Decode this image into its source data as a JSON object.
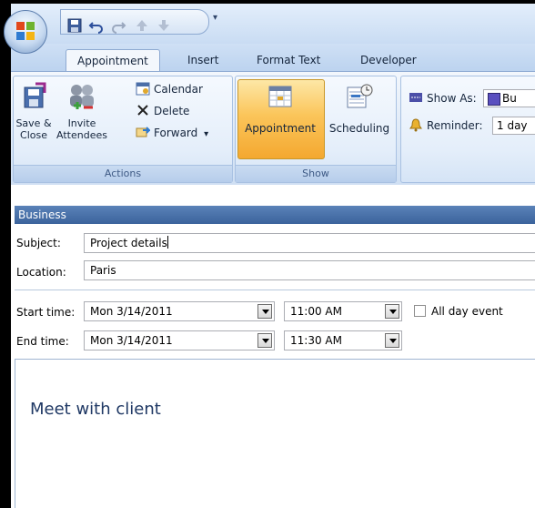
{
  "quick_access": {
    "buttons": [
      "save-icon",
      "undo-icon",
      "redo-icon",
      "up-arrow-icon",
      "down-arrow-icon"
    ],
    "customize": "▾"
  },
  "tabs": [
    {
      "label": "Appointment",
      "active": true
    },
    {
      "label": "Insert",
      "active": false
    },
    {
      "label": "Format Text",
      "active": false
    },
    {
      "label": "Developer",
      "active": false
    }
  ],
  "ribbon": {
    "actions": {
      "label": "Actions",
      "save_close": [
        "Save &",
        "Close"
      ],
      "invite": [
        "Invite",
        "Attendees"
      ],
      "calendar": "Calendar",
      "delete": "Delete",
      "forward": "Forward",
      "forward_arrow": "▾"
    },
    "show": {
      "label": "Show",
      "appointment": "Appointment",
      "scheduling": "Scheduling"
    },
    "options": {
      "show_as_label": "Show As:",
      "show_as_value": "Bu",
      "reminder_label": "Reminder:",
      "reminder_value": "1 day"
    }
  },
  "form": {
    "category": "Business",
    "subject_label": "Subject:",
    "subject_value": "Project details",
    "location_label": "Location:",
    "location_value": "Paris",
    "start_label": "Start time:",
    "start_date": "Mon 3/14/2011",
    "start_time": "11:00 AM",
    "all_day_label": "All day event",
    "end_label": "End time:",
    "end_date": "Mon 3/14/2011",
    "end_time": "11:30 AM",
    "notes": "Meet with client"
  },
  "colors": {
    "accent": "#3b639c",
    "active_button": "#fbc55a",
    "ribbon": "#dde9f7"
  }
}
